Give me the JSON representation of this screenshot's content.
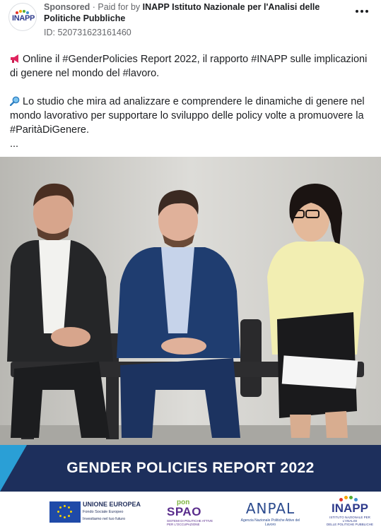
{
  "header": {
    "sponsored": "Sponsored",
    "separator": " · ",
    "paid_for_prefix": "Paid for by ",
    "advertiser": "INAPP Istituto Nazionale per l'Analisi delle Politiche Pubbliche",
    "ad_id": "ID: 520731623161460",
    "avatar_text": "INAPP",
    "more_icon": "more-horizontal-icon"
  },
  "post": {
    "paragraph1_emoji": "megaphone-icon",
    "paragraph1": "Online il #GenderPolicies Report 2022, il rapporto #INAPP sulle implicazioni di genere nel mondo del #lavoro.",
    "paragraph2_emoji": "magnifier-icon",
    "paragraph2": "Lo studio che mira ad analizzare e comprendere le dinamiche di genere nel mondo lavorativo per supportare lo sviluppo delle policy volte a promuovere la #ParitàDiGenere.",
    "ellipsis": "..."
  },
  "creative": {
    "banner_title": "GENDER POLICIES REPORT 2022",
    "logos": {
      "eu_title": "UNIONE EUROPEA",
      "eu_sub1": "Fondo Sociale Europeo",
      "eu_sub2": "Investiamo nel tuo futuro",
      "pon_top": "pon",
      "pon_main": "SPAO",
      "pon_sub": "SISTEMI DI POLITICHE ATTIVE PER L'OCCUPAZIONE",
      "anpal_main": "ANPAL",
      "anpal_sub": "Agenzia Nazionale Politiche Attive del Lavoro",
      "inapp_main": "INAPP",
      "inapp_sub1": "ISTITUTO NAZIONALE PER L'ANALISI",
      "inapp_sub2": "DELLE POLITICHE PUBBLICHE"
    }
  },
  "colors": {
    "banner_bg": "#1d2f5c",
    "banner_accent": "#2a9fd6",
    "text_secondary": "#65676b",
    "text_primary": "#1c1e21"
  }
}
